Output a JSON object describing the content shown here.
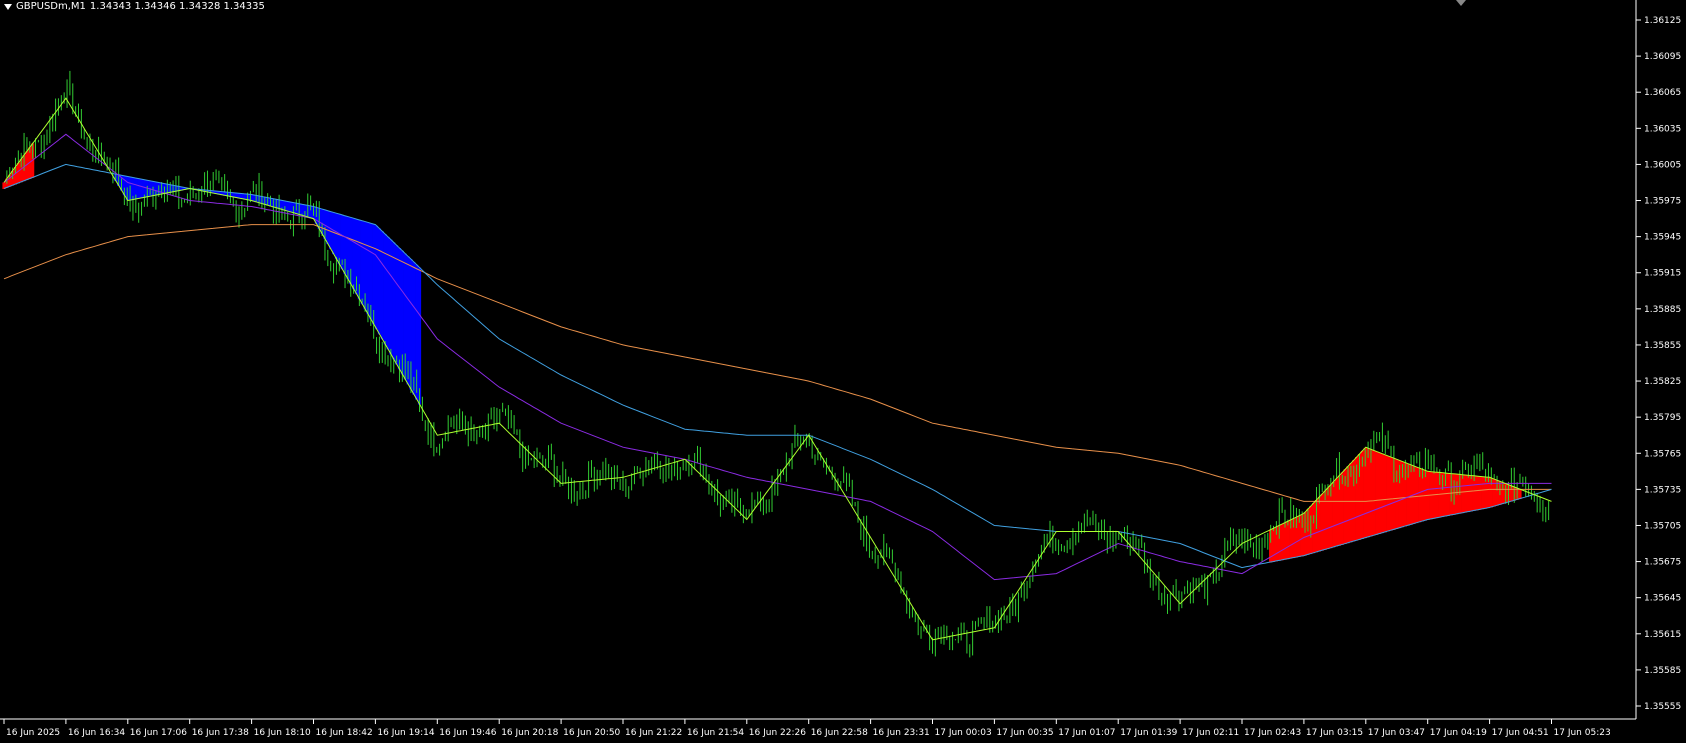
{
  "header": {
    "symbol_timeframe": "GBPUSDm,M1",
    "ohlc": "1.34343 1.34346 1.34328 1.34335"
  },
  "icons": {
    "menu": "triangle-down-icon",
    "shift_marker": "chart-shift-icon"
  },
  "colors": {
    "background": "#000000",
    "candles": "#32CD32",
    "fast_ma": "#ADFF2F",
    "ma_purple": "#8A2BE2",
    "ma_blue": "#40A0E0",
    "ma_orange": "#E8904A",
    "bear_fill": "#0000FF",
    "bull_fill": "#FF0000",
    "axis_text": "#FFFFFF"
  },
  "price_axis": {
    "ticks": [
      "1.36125",
      "1.36095",
      "1.36065",
      "1.36035",
      "1.36005",
      "1.35975",
      "1.35945",
      "1.35915",
      "1.35885",
      "1.35855",
      "1.35825",
      "1.35795",
      "1.35765",
      "1.35735",
      "1.35705",
      "1.35675",
      "1.35645",
      "1.35615",
      "1.35585",
      "1.35555"
    ]
  },
  "time_axis": {
    "ticks": [
      "16 Jun 2025",
      "16 Jun 16:34",
      "16 Jun 17:06",
      "16 Jun 17:38",
      "16 Jun 18:10",
      "16 Jun 18:42",
      "16 Jun 19:14",
      "16 Jun 19:46",
      "16 Jun 20:18",
      "16 Jun 20:50",
      "16 Jun 21:22",
      "16 Jun 21:54",
      "16 Jun 22:26",
      "16 Jun 22:58",
      "16 Jun 23:31",
      "17 Jun 00:03",
      "17 Jun 00:35",
      "17 Jun 01:07",
      "17 Jun 01:39",
      "17 Jun 02:11",
      "17 Jun 02:43",
      "17 Jun 03:15",
      "17 Jun 03:47",
      "17 Jun 04:19",
      "17 Jun 04:51",
      "17 Jun 05:23"
    ]
  },
  "chart_data": {
    "type": "candlestick",
    "title": "GBPUSDm,M1",
    "yrange": [
      1.35555,
      1.36125
    ],
    "close_keypoints": [
      {
        "time": "16 Jun 2025",
        "price": 1.3599
      },
      {
        "time": "16 Jun 16:34",
        "price": 1.3606
      },
      {
        "time": "16 Jun 17:06",
        "price": 1.35975
      },
      {
        "time": "16 Jun 17:38",
        "price": 1.35985
      },
      {
        "time": "16 Jun 18:10",
        "price": 1.35975
      },
      {
        "time": "16 Jun 18:42",
        "price": 1.3596
      },
      {
        "time": "16 Jun 19:14",
        "price": 1.3587
      },
      {
        "time": "16 Jun 19:46",
        "price": 1.3578
      },
      {
        "time": "16 Jun 20:18",
        "price": 1.3579
      },
      {
        "time": "16 Jun 20:50",
        "price": 1.3574
      },
      {
        "time": "16 Jun 21:22",
        "price": 1.35745
      },
      {
        "time": "16 Jun 21:54",
        "price": 1.3576
      },
      {
        "time": "16 Jun 22:26",
        "price": 1.3571
      },
      {
        "time": "16 Jun 22:58",
        "price": 1.3578
      },
      {
        "time": "16 Jun 23:31",
        "price": 1.35695
      },
      {
        "time": "17 Jun 00:03",
        "price": 1.3561
      },
      {
        "time": "17 Jun 00:35",
        "price": 1.3562
      },
      {
        "time": "17 Jun 01:07",
        "price": 1.357
      },
      {
        "time": "17 Jun 01:39",
        "price": 1.357
      },
      {
        "time": "17 Jun 02:11",
        "price": 1.3564
      },
      {
        "time": "17 Jun 02:43",
        "price": 1.3569
      },
      {
        "time": "17 Jun 03:15",
        "price": 1.35715
      },
      {
        "time": "17 Jun 03:47",
        "price": 1.3577
      },
      {
        "time": "17 Jun 04:19",
        "price": 1.3575
      },
      {
        "time": "17 Jun 04:51",
        "price": 1.35745
      },
      {
        "time": "17 Jun 05:23",
        "price": 1.35725
      }
    ],
    "ma_purple_keypoints": [
      1.3599,
      1.3603,
      1.3599,
      1.35975,
      1.3597,
      1.3596,
      1.3593,
      1.3586,
      1.3582,
      1.3579,
      1.3577,
      1.3576,
      1.35745,
      1.35735,
      1.35725,
      1.357,
      1.3566,
      1.35665,
      1.3569,
      1.35675,
      1.35665,
      1.35695,
      1.35715,
      1.35735,
      1.3574,
      1.3574
    ],
    "ma_blue_keypoints": [
      1.35985,
      1.36005,
      1.35995,
      1.35985,
      1.3598,
      1.3597,
      1.35955,
      1.35905,
      1.3586,
      1.3583,
      1.35805,
      1.35785,
      1.3578,
      1.3578,
      1.3576,
      1.35735,
      1.35705,
      1.357,
      1.357,
      1.3569,
      1.3567,
      1.3568,
      1.35695,
      1.3571,
      1.3572,
      1.35735
    ],
    "ma_orange_keypoints": [
      1.3591,
      1.3593,
      1.35945,
      1.3595,
      1.35955,
      1.35955,
      1.35935,
      1.3591,
      1.3589,
      1.3587,
      1.35855,
      1.35845,
      1.35835,
      1.35825,
      1.3581,
      1.3579,
      1.3578,
      1.3577,
      1.35765,
      1.35755,
      1.3574,
      1.35725,
      1.35725,
      1.3573,
      1.35735,
      1.35735
    ]
  }
}
